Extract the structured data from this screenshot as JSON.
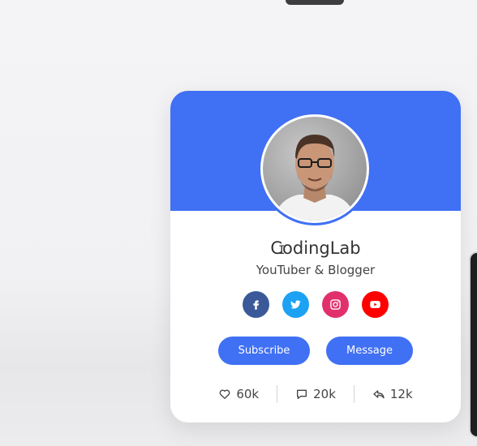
{
  "profile": {
    "name": "CodingLab",
    "job": "YouTuber & Blogger"
  },
  "socials": [
    {
      "icon": "facebook-icon",
      "color": "#3b5998"
    },
    {
      "icon": "twitter-icon",
      "color": "#1da1f2"
    },
    {
      "icon": "instagram-icon",
      "color": "#e1306c"
    },
    {
      "icon": "youtube-icon",
      "color": "#ff0000"
    }
  ],
  "buttons": {
    "subscribe": "Subscribe",
    "message": "Message"
  },
  "stats": {
    "likes": "60k",
    "comments": "20k",
    "shares": "12k"
  },
  "colors": {
    "accent": "#4070f4",
    "card": "#ffffff"
  }
}
